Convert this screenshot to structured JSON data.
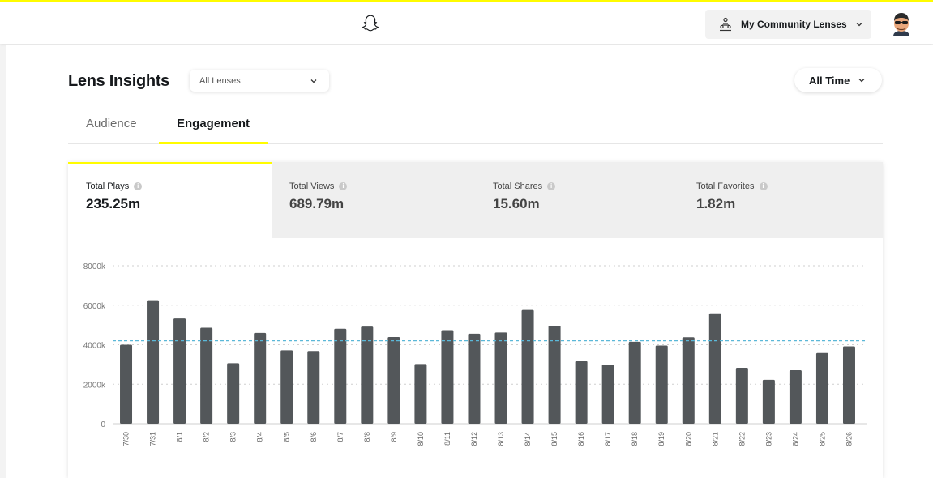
{
  "header": {
    "community_label": "My Community Lenses"
  },
  "page": {
    "title": "Lens Insights",
    "lens_filter": "All Lenses",
    "time_filter": "All Time"
  },
  "tabs": [
    {
      "label": "Audience",
      "active": false
    },
    {
      "label": "Engagement",
      "active": true
    }
  ],
  "metrics": [
    {
      "label": "Total Plays",
      "value": "235.25m",
      "active": true
    },
    {
      "label": "Total Views",
      "value": "689.79m",
      "active": false
    },
    {
      "label": "Total Shares",
      "value": "15.60m",
      "active": false
    },
    {
      "label": "Total Favorites",
      "value": "1.82m",
      "active": false
    }
  ],
  "colors": {
    "accent": "#fffc00",
    "bar": "#53575a",
    "average_line": "#5bb8d8"
  },
  "chart_data": {
    "type": "bar",
    "categories": [
      "7/30",
      "7/31",
      "8/1",
      "8/2",
      "8/3",
      "8/4",
      "8/5",
      "8/6",
      "8/7",
      "8/8",
      "8/9",
      "8/10",
      "8/11",
      "8/12",
      "8/13",
      "8/14",
      "8/15",
      "8/16",
      "8/17",
      "8/18",
      "8/19",
      "8/20",
      "8/21",
      "8/22",
      "8/23",
      "8/24",
      "8/25",
      "8/26"
    ],
    "values": [
      4000,
      6250,
      5330,
      4860,
      3060,
      4600,
      3720,
      3680,
      4810,
      4920,
      4390,
      3020,
      4740,
      4560,
      4620,
      5760,
      4960,
      3170,
      2990,
      4150,
      3960,
      4380,
      5590,
      2830,
      2220,
      2710,
      3580,
      3920
    ],
    "y_ticks": [
      "0",
      "2000k",
      "4000k",
      "6000k",
      "8000k"
    ],
    "ylim": [
      0,
      8000
    ],
    "average": 4200,
    "grid": true
  }
}
